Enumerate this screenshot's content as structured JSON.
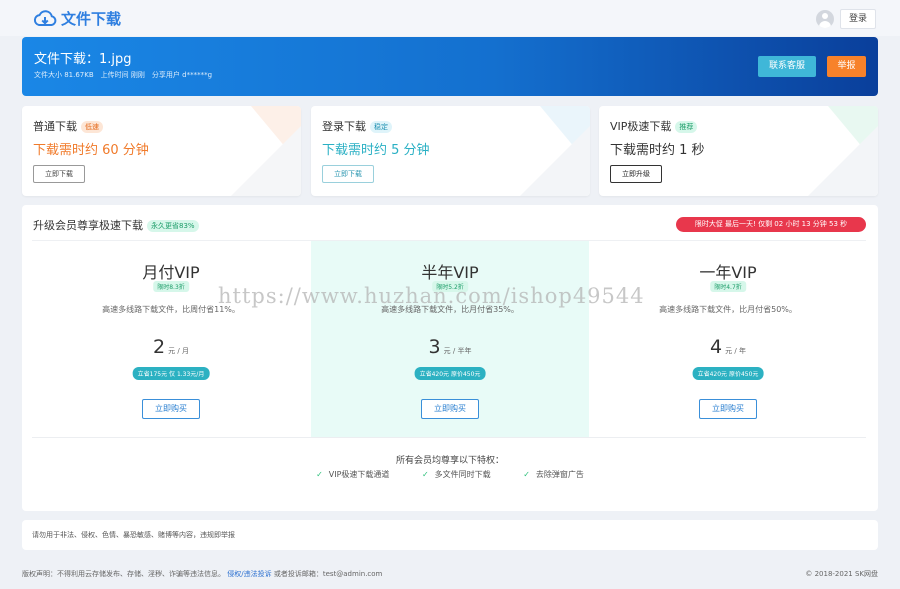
{
  "header": {
    "logo_text": "文件下载",
    "login_label": "登录"
  },
  "file": {
    "title": "文件下载：1.jpg",
    "size": "文件大小 81.67KB",
    "upload_time": "上传时间 刚刚",
    "share_user": "分享用户 d******g",
    "contact_label": "联系客服",
    "report_label": "举报"
  },
  "downloads": [
    {
      "name": "普通下载",
      "badge": "低速",
      "time": "下载需时约 60 分钟",
      "button": "立即下载",
      "color": "#f07a2a",
      "badge_bg": "#fde6d6",
      "badge_fg": "#e46a1c"
    },
    {
      "name": "登录下载",
      "badge": "稳定",
      "time": "下载需时约 5 分钟",
      "button": "立即下载",
      "color": "#2ab0c4",
      "badge_bg": "#dff4fa",
      "badge_fg": "#1c8fb0"
    },
    {
      "name": "VIP极速下载",
      "badge": "推荐",
      "time": "下载需时约 1 秒",
      "button": "立即升级",
      "color": "#333333",
      "badge_bg": "#d6f7ea",
      "badge_fg": "#1c9c68"
    }
  ],
  "vip": {
    "heading": "升级会员尊享极速下载",
    "heading_badge": "永久更省83%",
    "promo": "限时大促 最后一天! 仅剩 02 小时 13 分钟 53 秒",
    "plans": [
      {
        "name": "月付VIP",
        "discount": "限时8.3折",
        "desc": "高速多线路下载文件，比周付省11%。",
        "price": "2",
        "unit": "元 / 月",
        "save": "立省175元 仅 1.33元/月",
        "buy": "立即购买"
      },
      {
        "name": "半年VIP",
        "discount": "限时5.2折",
        "desc": "高速多线路下载文件，比月付省35%。",
        "price": "3",
        "unit": "元 / 半年",
        "save": "立省420元 原价450元",
        "buy": "立即购买"
      },
      {
        "name": "一年VIP",
        "discount": "限时4.7折",
        "desc": "高速多线路下载文件，比月付省50%。",
        "price": "4",
        "unit": "元 / 年",
        "save": "立省420元 原价450元",
        "buy": "立即购买"
      }
    ],
    "privileges_title": "所有会员均尊享以下特权：",
    "privileges": [
      "VIP极速下载通道",
      "多文件同时下载",
      "去除弹窗广告"
    ]
  },
  "notice": "请勿用于非法、侵权、色情、暴恐敏感、赌博等内容，违规即举报",
  "footer": {
    "disclaimer": "版权声明：不得利用云存储发布、存储、淫秽、诈骗等违法信息。",
    "report_link": "侵权/违法投诉",
    "contact": "或者投诉邮箱：test@admin.com",
    "copyright": "© 2018-2021 SK网盘"
  },
  "watermark": "https://www.huzhan.com/ishop49544"
}
